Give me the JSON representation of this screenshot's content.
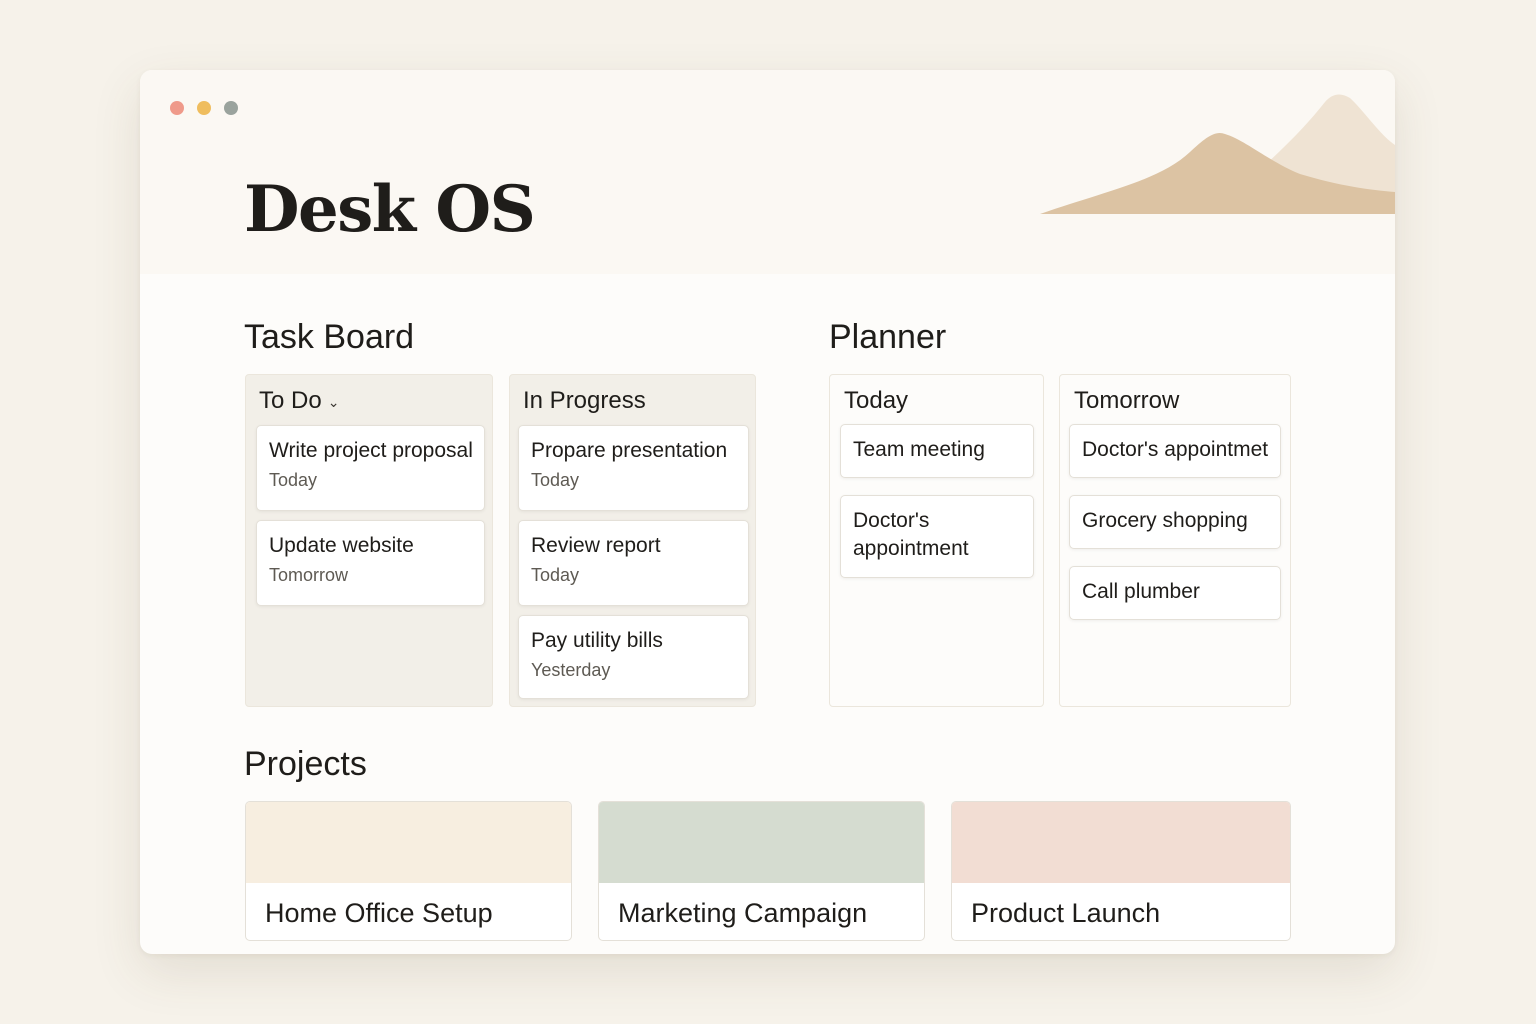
{
  "window": {
    "controls": [
      {
        "name": "close",
        "color": "#ef9a8a"
      },
      {
        "name": "minimize",
        "color": "#efbd5e"
      },
      {
        "name": "zoom",
        "color": "#9aa39d"
      }
    ]
  },
  "header": {
    "title": "Desk OS"
  },
  "colors": {
    "mountain_back": "#efe3d3",
    "mountain_front": "#dcc3a3",
    "board_column": "#f2efe8",
    "project_1_cover": "#f7eee0",
    "project_2_cover": "#d5dcd0",
    "project_3_cover": "#f2ddd3"
  },
  "task_board": {
    "title": "Task Board",
    "columns": [
      {
        "label": "To Do",
        "cards": [
          {
            "title": "Write project proposal",
            "due": "Today"
          },
          {
            "title": "Update website",
            "due": "Tomorrow"
          }
        ]
      },
      {
        "label": "In Progress",
        "cards": [
          {
            "title": "Propare presentation",
            "due": "Today"
          },
          {
            "title": "Review report",
            "due": "Today"
          },
          {
            "title": "Pay utility bills",
            "due": "Yesterday"
          }
        ]
      }
    ]
  },
  "planner": {
    "title": "Planner",
    "columns": [
      {
        "label": "Today",
        "items": [
          "Team meeting",
          "Doctor's appointment"
        ]
      },
      {
        "label": "Tomorrow",
        "items": [
          "Doctor's appointmet",
          "Grocery shopping",
          "Call plumber"
        ]
      }
    ]
  },
  "projects": {
    "title": "Projects",
    "items": [
      {
        "title": "Home Office Setup"
      },
      {
        "title": "Marketing Campaign"
      },
      {
        "title": "Product Launch"
      }
    ]
  }
}
